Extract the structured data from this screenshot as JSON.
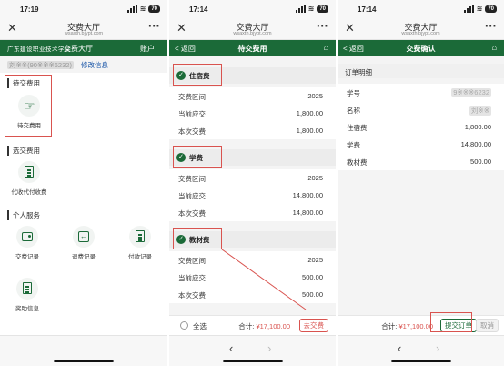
{
  "phones": [
    {
      "status": {
        "time": "17:19",
        "battery": "70"
      },
      "browser": {
        "title": "交费大厅",
        "url": "wsaxth.bjypt.com"
      },
      "header": {
        "logo_text": "广东建设职业技术学院",
        "title": "交费大厅",
        "right": "账户"
      },
      "user": {
        "name_id": "刘※※(90※※※6232)",
        "edit": "修改信息"
      },
      "sections": [
        {
          "title": "待交费用",
          "items": [
            {
              "label": "待交费用",
              "icon": "hand-card-icon"
            }
          ]
        },
        {
          "title": "选交费用",
          "items": [
            {
              "label": "代收代付收费",
              "icon": "document-icon"
            }
          ]
        },
        {
          "title": "个人服务",
          "items": [
            {
              "label": "交费记录",
              "icon": "wallet-icon"
            },
            {
              "label": "退费记录",
              "icon": "refund-icon"
            },
            {
              "label": "付款记录",
              "icon": "receipt-icon"
            },
            {
              "label": "奖助信息",
              "icon": "award-doc-icon"
            }
          ]
        }
      ]
    },
    {
      "status": {
        "time": "17:14",
        "battery": "70"
      },
      "browser": {
        "title": "交费大厅",
        "url": "wsaxth.bjypt.com"
      },
      "header": {
        "back": "< 返回",
        "title": "待交费用"
      },
      "fees": [
        {
          "name": "住宿费",
          "rows": [
            {
              "k": "交费区间",
              "v": "2025"
            },
            {
              "k": "当前应交",
              "v": "1,800.00"
            },
            {
              "k": "本次交费",
              "v": "1,800.00"
            }
          ]
        },
        {
          "name": "学费",
          "rows": [
            {
              "k": "交费区间",
              "v": "2025"
            },
            {
              "k": "当前应交",
              "v": "14,800.00"
            },
            {
              "k": "本次交费",
              "v": "14,800.00"
            }
          ]
        },
        {
          "name": "教材费",
          "rows": [
            {
              "k": "交费区间",
              "v": "2025"
            },
            {
              "k": "当前应交",
              "v": "500.00"
            },
            {
              "k": "本次交费",
              "v": "500.00"
            }
          ]
        }
      ],
      "footer": {
        "select_all": "全选",
        "total_label": "合计:",
        "total_amount": "¥17,100.00",
        "pay_button": "去交费"
      }
    },
    {
      "status": {
        "time": "17:14",
        "battery": "70"
      },
      "browser": {
        "title": "交费大厅",
        "url": "wsaxth.bjypt.com"
      },
      "header": {
        "back": "< 返回",
        "title": "交费确认"
      },
      "detail_title": "订单明细",
      "details": [
        {
          "k": "学号",
          "v": "9※※※6232"
        },
        {
          "k": "名称",
          "v": "刘※※"
        },
        {
          "k": "住宿费",
          "v": "1,800.00"
        },
        {
          "k": "学费",
          "v": "14,800.00"
        },
        {
          "k": "教材费",
          "v": "500.00"
        }
      ],
      "footer": {
        "total_label": "合计:",
        "total_amount": "¥17,100.00",
        "submit_button": "提交订单",
        "cancel_button": "取消"
      }
    }
  ],
  "nav": {
    "back_arrow": "‹",
    "forward_arrow": "›",
    "close": "✕",
    "more": "···",
    "home": "⌂",
    "check": "✓"
  },
  "colors": {
    "brand_green": "#1b6a38",
    "highlight_red": "#d9534f"
  }
}
